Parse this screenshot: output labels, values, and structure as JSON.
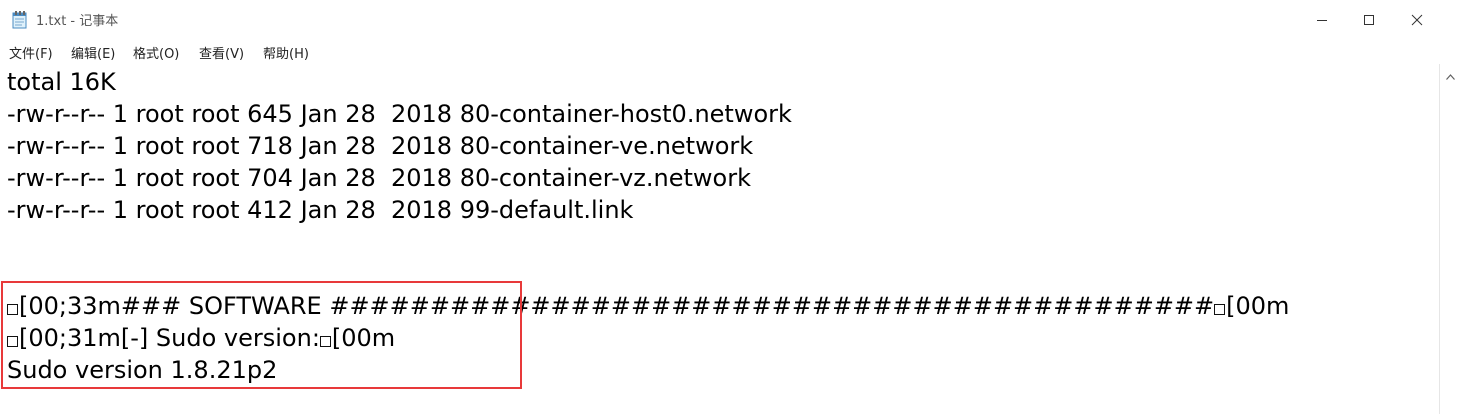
{
  "window": {
    "title": "1.txt - 记事本",
    "icon": "notepad-icon"
  },
  "controls": {
    "minimize_icon": "minimize-icon",
    "maximize_icon": "maximize-icon",
    "close_icon": "close-icon"
  },
  "menu": {
    "items": [
      {
        "label": "文件(F)"
      },
      {
        "label": "编辑(E)"
      },
      {
        "label": "格式(O)"
      },
      {
        "label": "查看(V)"
      },
      {
        "label": "帮助(H)"
      }
    ]
  },
  "document": {
    "lines": [
      {
        "text": "total 16K"
      },
      {
        "text": "-rw-r--r-- 1 root root 645 Jan 28  2018 80-container-host0.network"
      },
      {
        "text": "-rw-r--r-- 1 root root 718 Jan 28  2018 80-container-ve.network"
      },
      {
        "text": "-rw-r--r-- 1 root root 704 Jan 28  2018 80-container-vz.network"
      },
      {
        "text": "-rw-r--r-- 1 root root 412 Jan 28  2018 99-default.link"
      },
      {
        "text": ""
      },
      {
        "text": ""
      },
      {
        "prefix_glyph": "□",
        "text": "[00;33m### SOFTWARE ############################################",
        "suffix_glyph": "□",
        "suffix": "[00m"
      },
      {
        "prefix_glyph": "□",
        "text": "[00;31m[-] Sudo version:",
        "suffix_glyph": "□",
        "suffix": "[00m"
      },
      {
        "text": "Sudo version 1.8.21p2"
      }
    ]
  },
  "annotation": {
    "color": "#e8393a"
  }
}
